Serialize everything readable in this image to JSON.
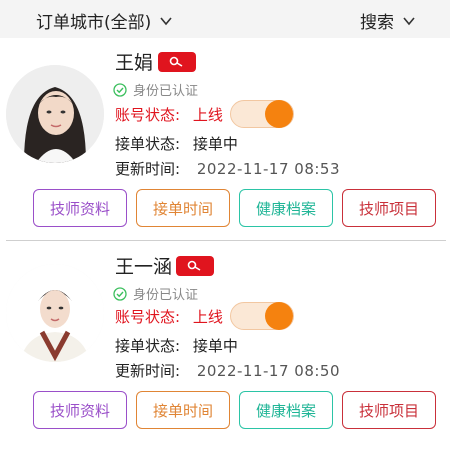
{
  "header": {
    "city_filter_label": "订单城市(全部)",
    "search_label": "搜索"
  },
  "technicians": [
    {
      "name": "王娟",
      "verified_label": "身份已认证",
      "account_status_label": "账号状态:",
      "account_status_value": "上线",
      "online": true,
      "order_status_label": "接单状态:",
      "order_status_value": "接单中",
      "updated_label": "更新时间:",
      "updated_value": "2022-11-17 08:53"
    },
    {
      "name": "王一涵",
      "verified_label": "身份已认证",
      "account_status_label": "账号状态:",
      "account_status_value": "上线",
      "online": true,
      "order_status_label": "接单状态:",
      "order_status_value": "接单中",
      "updated_label": "更新时间:",
      "updated_value": "2022-11-17 08:50"
    }
  ],
  "actions": {
    "profile": "技师资料",
    "schedule": "接单时间",
    "health": "健康档案",
    "services": "技师项目"
  },
  "colors": {
    "accent_red": "#e0141e",
    "toggle_orange": "#f5820f",
    "btn_purple": "#9a4fc9",
    "btn_orange": "#e08535",
    "btn_teal": "#2bc4a6",
    "btn_red": "#c9303a",
    "verified_green": "#3cbf5e"
  }
}
